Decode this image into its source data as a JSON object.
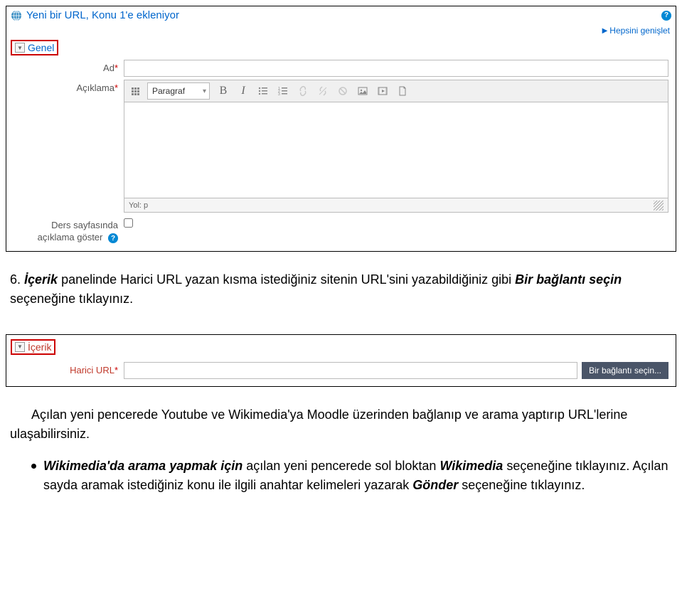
{
  "header": {
    "title": "Yeni bir URL, Konu 1'e ekleniyor",
    "expand_all": "Hepsini genişlet"
  },
  "section_general": {
    "label": "Genel",
    "name_label": "Ad",
    "description_label": "Açıklama",
    "paragraph_label": "Paragraf",
    "editor_path": "Yol: p",
    "show_description_label_line1": "Ders sayfasında",
    "show_description_label_line2": "açıklama göster"
  },
  "instruction_1_prefix": "6. ",
  "instruction_1_parts": {
    "p1": "İçerik",
    "p2": " panelinde Harici URL yazan kısma istediğiniz sitenin URL'sini yazabildiğiniz gibi ",
    "p3": "Bir bağlantı seçin",
    "p4": " seçeneğine tıklayınız."
  },
  "section_content": {
    "label": "İçerik",
    "external_url_label": "Harici URL",
    "choose_link_btn": "Bir bağlantı seçin..."
  },
  "instruction_2": "Açılan yeni pencerede Youtube ve Wikimedia'ya Moodle üzerinden bağlanıp ve arama yaptırıp URL'lerine ulaşabilirsiniz.",
  "bullet_parts": {
    "p1": "Wikimedia'da arama yapmak için",
    "p2": " açılan yeni pencerede sol bloktan ",
    "p3": "Wikimedia",
    "p4": " seçeneğine tıklayınız. Açılan sayda aramak istediğiniz konu ile ilgili anahtar kelimeleri yazarak ",
    "p5": "Gönder",
    "p6": " seçeneğine tıklayınız."
  },
  "toolbar_icons": {
    "expand": "expand-toolbar-icon",
    "bold": "B",
    "italic": "I",
    "ul": "bullet-list-icon",
    "ol": "number-list-icon",
    "link": "link-icon",
    "unlink": "unlink-icon",
    "nolink": "prevent-link-icon",
    "image": "image-icon",
    "media": "media-icon",
    "files": "files-icon"
  }
}
